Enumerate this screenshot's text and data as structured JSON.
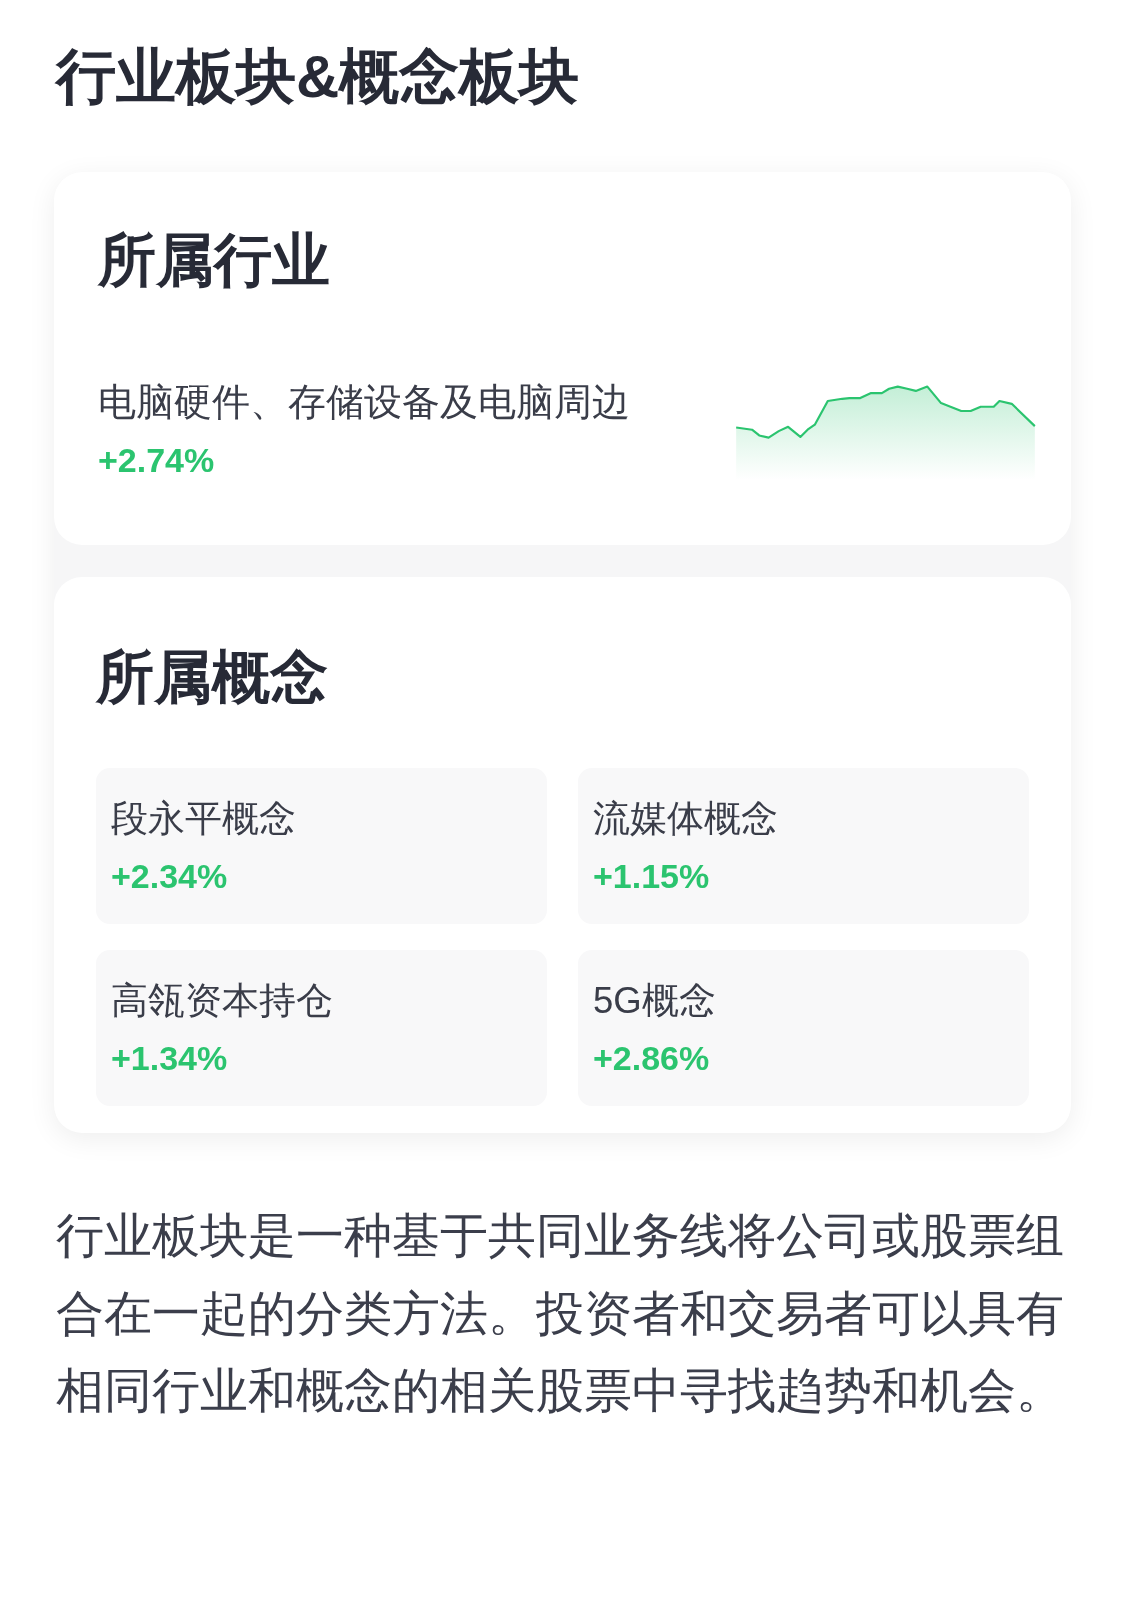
{
  "title": "行业板块&概念板块",
  "industry": {
    "heading": "所属行业",
    "name": "电脑硬件、存储设备及电脑周边",
    "change": "+2.74%"
  },
  "concepts": {
    "heading": "所属概念",
    "items": [
      {
        "name": "段永平概念",
        "change": "+2.34%"
      },
      {
        "name": "流媒体概念",
        "change": "+1.15%"
      },
      {
        "name": "高瓴资本持仓",
        "change": "+1.34%"
      },
      {
        "name": "5G概念",
        "change": "+2.86%"
      }
    ]
  },
  "description": "行业板块是一种基于共同业务线将公司或股票组合在一起的分类方法。投资者和交易者可以具有相同行业和概念的相关股票中寻找趋势和机会。"
}
